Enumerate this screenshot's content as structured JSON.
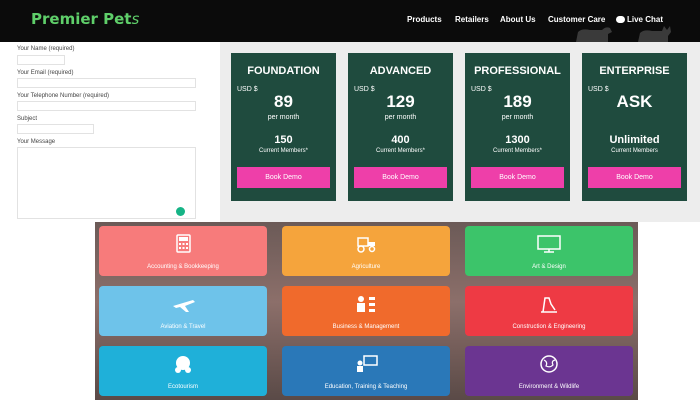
{
  "header": {
    "logo_main": "Premier Pet",
    "logo_tail": "s",
    "nav": [
      "Products",
      "Retailers",
      "About Us",
      "Customer Care",
      "Live Chat"
    ]
  },
  "form": {
    "name_label": "Your Name (required)",
    "email_label": "Your Email (required)",
    "phone_label": "Your Telephone Number (required)",
    "subject_label": "Subject",
    "message_label": "Your Message"
  },
  "pricing": [
    {
      "name": "FOUNDATION",
      "currency": "USD $",
      "price": "89",
      "period": "per month",
      "members": "150",
      "members_label": "Current Members*",
      "button": "Book Demo"
    },
    {
      "name": "ADVANCED",
      "currency": "USD $",
      "price": "129",
      "period": "per month",
      "members": "400",
      "members_label": "Current Members*",
      "button": "Book Demo"
    },
    {
      "name": "PROFESSIONAL",
      "currency": "USD $",
      "price": "189",
      "period": "per month",
      "members": "1300",
      "members_label": "Current Members*",
      "button": "Book Demo"
    },
    {
      "name": "ENTERPRISE",
      "currency": "USD $",
      "price": "ASK",
      "period": "",
      "members": "Unlimited",
      "members_label": "Current Members",
      "button": "Book Demo"
    }
  ],
  "categories": [
    {
      "label": "Accounting & Bookkeeping",
      "icon": "calculator-icon",
      "color": "#f77b7b"
    },
    {
      "label": "Agriculture",
      "icon": "tractor-icon",
      "color": "#f5a43c"
    },
    {
      "label": "Art & Design",
      "icon": "monitor-icon",
      "color": "#3cc46a"
    },
    {
      "label": "Aviation & Travel",
      "icon": "airplane-icon",
      "color": "#6ec3ea"
    },
    {
      "label": "Business & Management",
      "icon": "org-chart-icon",
      "color": "#f06a2c"
    },
    {
      "label": "Construction & Engineering",
      "icon": "crane-icon",
      "color": "#ee3a44"
    },
    {
      "label": "Ecotourism",
      "icon": "globe-people-icon",
      "color": "#1fb0d9"
    },
    {
      "label": "Education, Training & Teaching",
      "icon": "teacher-board-icon",
      "color": "#2a78b8"
    },
    {
      "label": "Environment & Wildlife",
      "icon": "earth-icon",
      "color": "#6b3591"
    }
  ],
  "colors": {
    "brand_green": "#5fcf6a",
    "card_green": "#1f4b3e",
    "demo_pink": "#ee3fa9"
  }
}
